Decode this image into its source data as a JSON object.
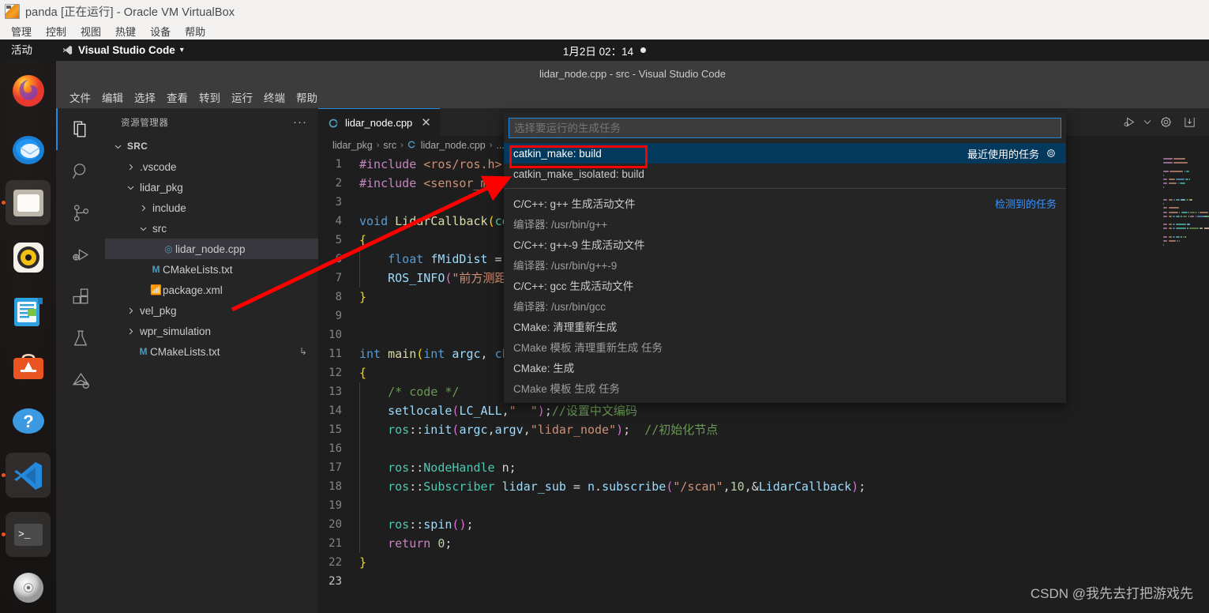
{
  "vbox": {
    "title": "panda [正在运行] - Oracle VM VirtualBox",
    "menu": [
      "管理",
      "控制",
      "视图",
      "热键",
      "设备",
      "帮助"
    ]
  },
  "gnome": {
    "activities": "活动",
    "app_name": "Visual Studio Code",
    "app_caret": "▾",
    "clock": "1月2日  02：14"
  },
  "dock": {
    "items": [
      {
        "name": "firefox",
        "label": "Firefox",
        "running": false
      },
      {
        "name": "thunderbird",
        "label": "Thunderbird",
        "running": false
      },
      {
        "name": "files",
        "label": "文件",
        "running": true
      },
      {
        "name": "rhythmbox",
        "label": "Rhythmbox",
        "running": false
      },
      {
        "name": "libreoffice-writer",
        "label": "LibreOffice Writer",
        "running": false
      },
      {
        "name": "ubuntu-software",
        "label": "Ubuntu Software",
        "running": false
      },
      {
        "name": "help",
        "label": "帮助",
        "running": false
      },
      {
        "name": "vscode",
        "label": "Visual Studio Code",
        "running": true
      },
      {
        "name": "terminal",
        "label": "终端",
        "running": true
      },
      {
        "name": "disc",
        "label": "光盘",
        "running": false
      }
    ]
  },
  "vscode": {
    "window_title": "lidar_node.cpp - src - Visual Studio Code",
    "menubar": [
      "文件",
      "编辑",
      "选择",
      "查看",
      "转到",
      "运行",
      "终端",
      "帮助"
    ],
    "activitybar": [
      {
        "icon": "explorer-icon",
        "label": "资源管理器",
        "active": true
      },
      {
        "icon": "search-icon",
        "label": "搜索",
        "active": false
      },
      {
        "icon": "source-control-icon",
        "label": "源代码管理",
        "active": false
      },
      {
        "icon": "run-debug-icon",
        "label": "运行和调试",
        "active": false
      },
      {
        "icon": "extensions-icon",
        "label": "扩展",
        "active": false
      },
      {
        "icon": "testing-icon",
        "label": "测试",
        "active": false
      },
      {
        "icon": "ros-icon",
        "label": "ROS",
        "active": false
      }
    ],
    "explorer": {
      "title": "资源管理器",
      "more_actions": "···",
      "tree": [
        {
          "label": "SRC",
          "depth": 0,
          "type": "root",
          "twisty": "down",
          "selected": false
        },
        {
          "label": ".vscode",
          "depth": 1,
          "type": "folder",
          "twisty": "right",
          "selected": false
        },
        {
          "label": "lidar_pkg",
          "depth": 1,
          "type": "folder",
          "twisty": "down",
          "selected": false
        },
        {
          "label": "include",
          "depth": 2,
          "type": "folder",
          "twisty": "right",
          "selected": false
        },
        {
          "label": "src",
          "depth": 2,
          "type": "folder",
          "twisty": "down",
          "selected": false
        },
        {
          "label": "lidar_node.cpp",
          "depth": 3,
          "type": "cpp",
          "twisty": "none",
          "selected": true
        },
        {
          "label": "CMakeLists.txt",
          "depth": 2,
          "type": "md",
          "twisty": "none",
          "selected": false
        },
        {
          "label": "package.xml",
          "depth": 2,
          "type": "xml",
          "twisty": "none",
          "selected": false
        },
        {
          "label": "vel_pkg",
          "depth": 1,
          "type": "folder",
          "twisty": "right",
          "selected": false
        },
        {
          "label": "wpr_simulation",
          "depth": 1,
          "type": "folder",
          "twisty": "right",
          "selected": false
        },
        {
          "label": "CMakeLists.txt",
          "depth": 1,
          "type": "md",
          "twisty": "none",
          "selected": false,
          "trailing": "↳"
        }
      ]
    },
    "tab": {
      "label": "lidar_node.cpp",
      "close": "✕",
      "icon": "cpp-file-icon"
    },
    "editor_actions": [
      {
        "name": "run-or-debug-icon",
        "label": "运行或调试"
      },
      {
        "name": "chevron-down-icon",
        "label": "更多"
      },
      {
        "name": "gear-icon",
        "label": "设置"
      },
      {
        "name": "split-editor-icon",
        "label": "安装"
      }
    ],
    "breadcrumb": [
      "lidar_pkg",
      "src",
      "lidar_node.cpp",
      "..."
    ],
    "breadcrumb_sep": "›",
    "code": [
      {
        "n": 1,
        "tokens": [
          {
            "t": "#include ",
            "c": "k-inc"
          },
          {
            "t": "<ros/ros.h>",
            "c": "k-str"
          }
        ]
      },
      {
        "n": 2,
        "tokens": [
          {
            "t": "#include ",
            "c": "k-inc"
          },
          {
            "t": "<sensor_msgs/",
            "c": "k-str"
          }
        ]
      },
      {
        "n": 3,
        "tokens": []
      },
      {
        "n": 4,
        "tokens": [
          {
            "t": "void ",
            "c": "k-type"
          },
          {
            "t": "LidarCallback",
            "c": "k-fn"
          },
          {
            "t": "(",
            "c": "br-y"
          },
          {
            "t": "con",
            "c": "k-ns"
          }
        ]
      },
      {
        "n": 5,
        "tokens": [
          {
            "t": "{",
            "c": "br-y"
          }
        ]
      },
      {
        "n": 6,
        "tokens": [
          {
            "t": "    ",
            "c": "k-plain"
          },
          {
            "t": "float ",
            "c": "k-type"
          },
          {
            "t": "fMidDist",
            "c": "k-id"
          },
          {
            "t": " = ",
            "c": "k-plain"
          },
          {
            "t": "m",
            "c": "k-id"
          }
        ],
        "guides": 1
      },
      {
        "n": 7,
        "tokens": [
          {
            "t": "    ",
            "c": "k-plain"
          },
          {
            "t": "ROS_INFO",
            "c": "k-id"
          },
          {
            "t": "(",
            "c": "br-p"
          },
          {
            "t": "\"前方测距",
            "c": "k-str"
          }
        ],
        "guides": 1
      },
      {
        "n": 8,
        "tokens": [
          {
            "t": "}",
            "c": "br-y"
          }
        ]
      },
      {
        "n": 9,
        "tokens": []
      },
      {
        "n": 10,
        "tokens": []
      },
      {
        "n": 11,
        "tokens": [
          {
            "t": "int ",
            "c": "k-type"
          },
          {
            "t": "main",
            "c": "k-fn"
          },
          {
            "t": "(",
            "c": "br-y"
          },
          {
            "t": "int ",
            "c": "k-type"
          },
          {
            "t": "argc",
            "c": "k-id"
          },
          {
            "t": ", ",
            "c": "k-plain"
          },
          {
            "t": "cha",
            "c": "k-type"
          }
        ]
      },
      {
        "n": 12,
        "tokens": [
          {
            "t": "{",
            "c": "br-y"
          }
        ]
      },
      {
        "n": 13,
        "tokens": [
          {
            "t": "    ",
            "c": "k-plain"
          },
          {
            "t": "/* code */",
            "c": "k-cmt"
          }
        ],
        "guides": 1
      },
      {
        "n": 14,
        "tokens": [
          {
            "t": "    ",
            "c": "k-plain"
          },
          {
            "t": "setlocale",
            "c": "k-id"
          },
          {
            "t": "(",
            "c": "br-p"
          },
          {
            "t": "LC_ALL",
            "c": "k-id"
          },
          {
            "t": ",",
            "c": "k-plain"
          },
          {
            "t": "\"  \"",
            "c": "k-str"
          },
          {
            "t": ")",
            "c": "br-p"
          },
          {
            "t": ";",
            "c": "k-plain"
          },
          {
            "t": "//设置中文编码",
            "c": "k-cmt"
          }
        ],
        "guides": 1
      },
      {
        "n": 15,
        "tokens": [
          {
            "t": "    ",
            "c": "k-plain"
          },
          {
            "t": "ros",
            "c": "k-ns"
          },
          {
            "t": "::",
            "c": "k-plain"
          },
          {
            "t": "init",
            "c": "k-id"
          },
          {
            "t": "(",
            "c": "br-p"
          },
          {
            "t": "argc",
            "c": "k-id"
          },
          {
            "t": ",",
            "c": "k-plain"
          },
          {
            "t": "argv",
            "c": "k-id"
          },
          {
            "t": ",",
            "c": "k-plain"
          },
          {
            "t": "\"lidar_node\"",
            "c": "k-str"
          },
          {
            "t": ")",
            "c": "br-p"
          },
          {
            "t": ";  ",
            "c": "k-plain"
          },
          {
            "t": "//初始化节点",
            "c": "k-cmt"
          }
        ],
        "guides": 1
      },
      {
        "n": 16,
        "tokens": [],
        "guides": 1
      },
      {
        "n": 17,
        "tokens": [
          {
            "t": "    ",
            "c": "k-plain"
          },
          {
            "t": "ros",
            "c": "k-ns"
          },
          {
            "t": "::",
            "c": "k-plain"
          },
          {
            "t": "NodeHandle",
            "c": "k-ns"
          },
          {
            "t": " n;",
            "c": "k-plain"
          }
        ],
        "guides": 1
      },
      {
        "n": 18,
        "tokens": [
          {
            "t": "    ",
            "c": "k-plain"
          },
          {
            "t": "ros",
            "c": "k-ns"
          },
          {
            "t": "::",
            "c": "k-plain"
          },
          {
            "t": "Subscriber",
            "c": "k-ns"
          },
          {
            "t": " ",
            "c": "k-plain"
          },
          {
            "t": "lidar_sub",
            "c": "k-id"
          },
          {
            "t": " = ",
            "c": "k-plain"
          },
          {
            "t": "n",
            "c": "k-id"
          },
          {
            "t": ".",
            "c": "k-plain"
          },
          {
            "t": "subscribe",
            "c": "k-id"
          },
          {
            "t": "(",
            "c": "br-p"
          },
          {
            "t": "\"/scan\"",
            "c": "k-str"
          },
          {
            "t": ",",
            "c": "k-plain"
          },
          {
            "t": "10",
            "c": "k-num"
          },
          {
            "t": ",&",
            "c": "k-plain"
          },
          {
            "t": "LidarCallback",
            "c": "k-id"
          },
          {
            "t": ")",
            "c": "br-p"
          },
          {
            "t": ";",
            "c": "k-plain"
          }
        ],
        "guides": 1
      },
      {
        "n": 19,
        "tokens": [],
        "guides": 1
      },
      {
        "n": 20,
        "tokens": [
          {
            "t": "    ",
            "c": "k-plain"
          },
          {
            "t": "ros",
            "c": "k-ns"
          },
          {
            "t": "::",
            "c": "k-plain"
          },
          {
            "t": "spin",
            "c": "k-id"
          },
          {
            "t": "(",
            "c": "br-p"
          },
          {
            "t": ")",
            "c": "br-p"
          },
          {
            "t": ";",
            "c": "k-plain"
          }
        ],
        "guides": 1
      },
      {
        "n": 21,
        "tokens": [
          {
            "t": "    ",
            "c": "k-plain"
          },
          {
            "t": "return ",
            "c": "k-inc"
          },
          {
            "t": "0",
            "c": "k-num"
          },
          {
            "t": ";",
            "c": "k-plain"
          }
        ],
        "guides": 1
      },
      {
        "n": 22,
        "tokens": [
          {
            "t": "}",
            "c": "br-y"
          }
        ]
      },
      {
        "n": 23,
        "tokens": [],
        "current": true
      }
    ]
  },
  "quickpick": {
    "placeholder": "选择要运行的生成任务",
    "value": "",
    "groups": [
      {
        "separator": false,
        "rows": [
          {
            "label": "catkin_make: build",
            "right": "最近使用的任务",
            "gear": true,
            "selected": true,
            "muted": false,
            "right_blue": false
          },
          {
            "label": "catkin_make_isolated: build",
            "right": "",
            "gear": false,
            "selected": false,
            "muted": false,
            "right_blue": false
          }
        ]
      },
      {
        "separator": true,
        "rows": [
          {
            "label": "C/C++: g++ 生成活动文件",
            "right": "检测到的任务",
            "gear": false,
            "selected": false,
            "muted": false,
            "right_blue": true
          },
          {
            "label": "编译器: /usr/bin/g++",
            "right": "",
            "gear": false,
            "selected": false,
            "muted": true,
            "right_blue": false
          },
          {
            "label": "C/C++: g++-9 生成活动文件",
            "right": "",
            "gear": false,
            "selected": false,
            "muted": false,
            "right_blue": false
          },
          {
            "label": "编译器: /usr/bin/g++-9",
            "right": "",
            "gear": false,
            "selected": false,
            "muted": true,
            "right_blue": false
          },
          {
            "label": "C/C++: gcc 生成活动文件",
            "right": "",
            "gear": false,
            "selected": false,
            "muted": false,
            "right_blue": false
          },
          {
            "label": "编译器: /usr/bin/gcc",
            "right": "",
            "gear": false,
            "selected": false,
            "muted": true,
            "right_blue": false
          },
          {
            "label": "CMake: 清理重新生成",
            "right": "",
            "gear": false,
            "selected": false,
            "muted": false,
            "right_blue": false
          },
          {
            "label": "CMake 模板 清理重新生成 任务",
            "right": "",
            "gear": false,
            "selected": false,
            "muted": true,
            "right_blue": false
          },
          {
            "label": "CMake: 生成",
            "right": "",
            "gear": false,
            "selected": false,
            "muted": false,
            "right_blue": false
          },
          {
            "label": "CMake 模板 生成 任务",
            "right": "",
            "gear": false,
            "selected": false,
            "muted": true,
            "right_blue": false
          }
        ]
      }
    ]
  },
  "annotation": {
    "highlight_color": "#fe0000",
    "arrow_color": "#fe0000",
    "watermark": "CSDN @我先去打把游戏先"
  }
}
